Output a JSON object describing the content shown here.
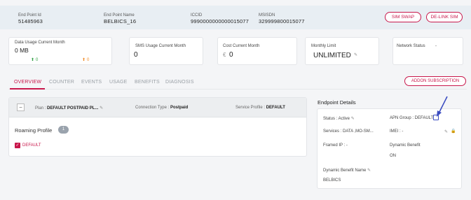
{
  "header": {
    "fields": [
      {
        "label": "End Point Id",
        "value": "51485963"
      },
      {
        "label": "End Point Name",
        "value": "BELBICS_16"
      },
      {
        "label": "ICCID",
        "value": "9990000000000015077"
      },
      {
        "label": "MSISDN",
        "value": "329999800015077"
      }
    ],
    "sim_swap": "SIM SWAP",
    "delink_sim": "DE-LINK SIM"
  },
  "cards": {
    "data_usage": {
      "title": "Data Usage Current Month",
      "value": "0 MB",
      "up": "0",
      "down": "0"
    },
    "sms_usage": {
      "title": "SMS Usage Current Month",
      "value": "0"
    },
    "cost": {
      "title": "Cost Current Month",
      "currency": "€",
      "value": "0"
    },
    "monthly_limit": {
      "title": "Monthly Limit",
      "value": "UNLIMITED"
    },
    "network_status": {
      "title": "Network Status",
      "value": "-"
    }
  },
  "tabs": [
    "OVERVIEW",
    "COUNTER",
    "EVENTS",
    "USAGE",
    "BENEFITS",
    "DIAGNOSIS"
  ],
  "addon_button": "ADDON SUBSCRIPTION",
  "plan": {
    "plan_label": "Plan :",
    "plan_value": "DEFAULT POSTPAID PL...",
    "connection_label": "Connection Type :",
    "connection_value": "Postpaid",
    "service_label": "Service Profile :",
    "service_value": "DEFAULT",
    "roaming_title": "Roaming Profile",
    "roaming_count": "1",
    "roaming_item": "DEFAULT"
  },
  "endpoint": {
    "title": "Endpoint Details",
    "status": "Status : Active",
    "apn_group": "APN Group : DEFAULT",
    "services": "Services : DATA ,MO-SM...",
    "imei": "IMEI : -",
    "framed_ip": "Framed IP : -",
    "dynamic_benefit_label": "Dynamic Benefit",
    "dynamic_benefit_value": "ON",
    "dynamic_benefit_name_label": "Dynamic Benefit Name",
    "dynamic_benefit_name_value": "BELBICS"
  },
  "colors": {
    "accent": "#c8174b",
    "header_bg": "#e8eef3",
    "annotation": "#3b4cc0"
  }
}
